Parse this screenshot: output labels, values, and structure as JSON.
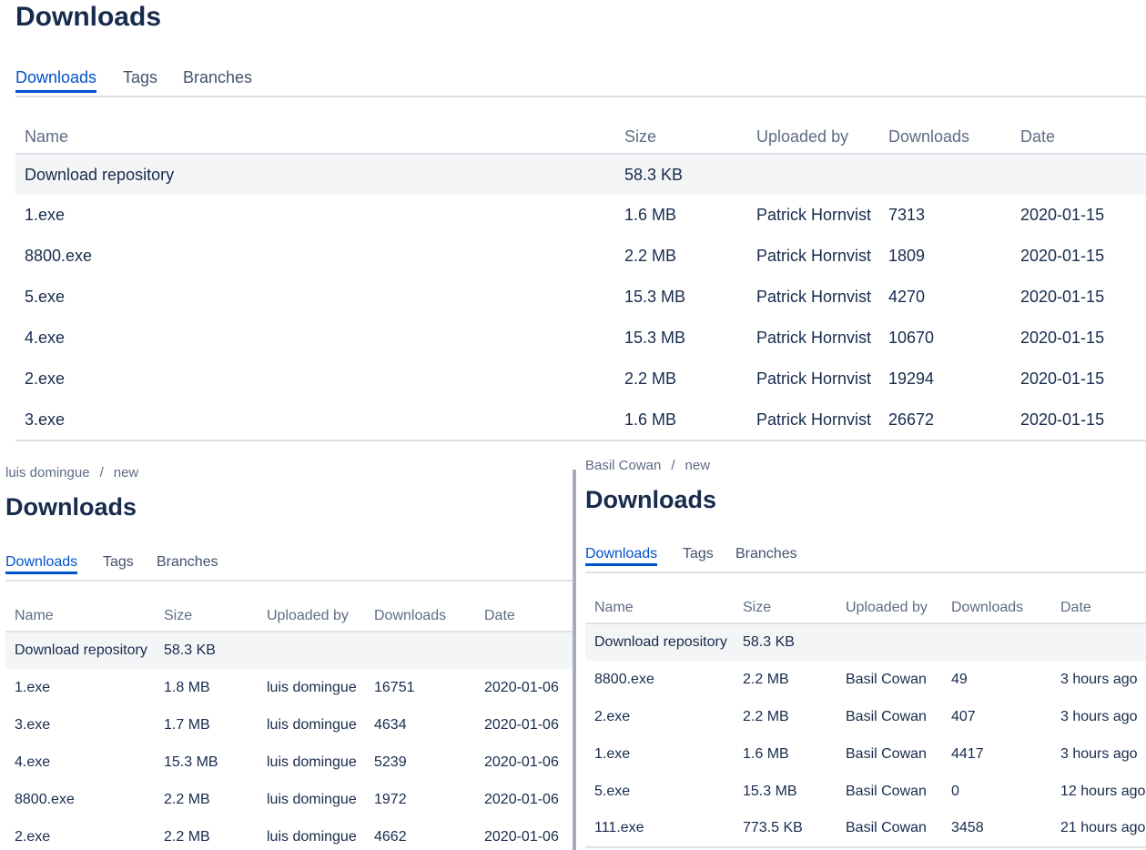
{
  "panel_top": {
    "title": "Downloads",
    "tabs": [
      {
        "label": "Downloads",
        "active": true
      },
      {
        "label": "Tags",
        "active": false
      },
      {
        "label": "Branches",
        "active": false
      }
    ],
    "columns": [
      "Name",
      "Size",
      "Uploaded by",
      "Downloads",
      "Date"
    ],
    "repo_row": {
      "name": "Download repository",
      "size": "58.3 KB"
    },
    "rows": [
      {
        "name": "1.exe",
        "size": "1.6 MB",
        "uploader": "Patrick Hornvist",
        "downloads": "7313",
        "date": "2020-01-15"
      },
      {
        "name": "8800.exe",
        "size": "2.2 MB",
        "uploader": "Patrick Hornvist",
        "downloads": "1809",
        "date": "2020-01-15"
      },
      {
        "name": "5.exe",
        "size": "15.3 MB",
        "uploader": "Patrick Hornvist",
        "downloads": "4270",
        "date": "2020-01-15"
      },
      {
        "name": "4.exe",
        "size": "15.3 MB",
        "uploader": "Patrick Hornvist",
        "downloads": "10670",
        "date": "2020-01-15"
      },
      {
        "name": "2.exe",
        "size": "2.2 MB",
        "uploader": "Patrick Hornvist",
        "downloads": "19294",
        "date": "2020-01-15"
      },
      {
        "name": "3.exe",
        "size": "1.6 MB",
        "uploader": "Patrick Hornvist",
        "downloads": "26672",
        "date": "2020-01-15"
      }
    ]
  },
  "panel_left": {
    "breadcrumb": {
      "owner": "luis domingue",
      "separator": "/",
      "repo": "new"
    },
    "title": "Downloads",
    "tabs": [
      {
        "label": "Downloads",
        "active": true
      },
      {
        "label": "Tags",
        "active": false
      },
      {
        "label": "Branches",
        "active": false
      }
    ],
    "columns": [
      "Name",
      "Size",
      "Uploaded by",
      "Downloads",
      "Date"
    ],
    "repo_row": {
      "name": "Download repository",
      "size": "58.3 KB"
    },
    "rows": [
      {
        "name": "1.exe",
        "size": "1.8 MB",
        "uploader": "luis domingue",
        "downloads": "16751",
        "date": "2020-01-06"
      },
      {
        "name": "3.exe",
        "size": "1.7 MB",
        "uploader": "luis domingue",
        "downloads": "4634",
        "date": "2020-01-06"
      },
      {
        "name": "4.exe",
        "size": "15.3 MB",
        "uploader": "luis domingue",
        "downloads": "5239",
        "date": "2020-01-06"
      },
      {
        "name": "8800.exe",
        "size": "2.2 MB",
        "uploader": "luis domingue",
        "downloads": "1972",
        "date": "2020-01-06"
      },
      {
        "name": "2.exe",
        "size": "2.2 MB",
        "uploader": "luis domingue",
        "downloads": "4662",
        "date": "2020-01-06"
      }
    ]
  },
  "panel_right": {
    "breadcrumb": {
      "owner": "Basil Cowan",
      "separator": "/",
      "repo": "new"
    },
    "title": "Downloads",
    "tabs": [
      {
        "label": "Downloads",
        "active": true
      },
      {
        "label": "Tags",
        "active": false
      },
      {
        "label": "Branches",
        "active": false
      }
    ],
    "columns": [
      "Name",
      "Size",
      "Uploaded by",
      "Downloads",
      "Date"
    ],
    "repo_row": {
      "name": "Download repository",
      "size": "58.3 KB"
    },
    "rows": [
      {
        "name": "8800.exe",
        "size": "2.2 MB",
        "uploader": "Basil Cowan",
        "downloads": "49",
        "date": "3 hours ago"
      },
      {
        "name": "2.exe",
        "size": "2.2 MB",
        "uploader": "Basil Cowan",
        "downloads": "407",
        "date": "3 hours ago"
      },
      {
        "name": "1.exe",
        "size": "1.6 MB",
        "uploader": "Basil Cowan",
        "downloads": "4417",
        "date": "3 hours ago"
      },
      {
        "name": "5.exe",
        "size": "15.3 MB",
        "uploader": "Basil Cowan",
        "downloads": "0",
        "date": "12 hours ago"
      },
      {
        "name": "111.exe",
        "size": "773.5 KB",
        "uploader": "Basil Cowan",
        "downloads": "3458",
        "date": "21 hours ago"
      }
    ]
  }
}
